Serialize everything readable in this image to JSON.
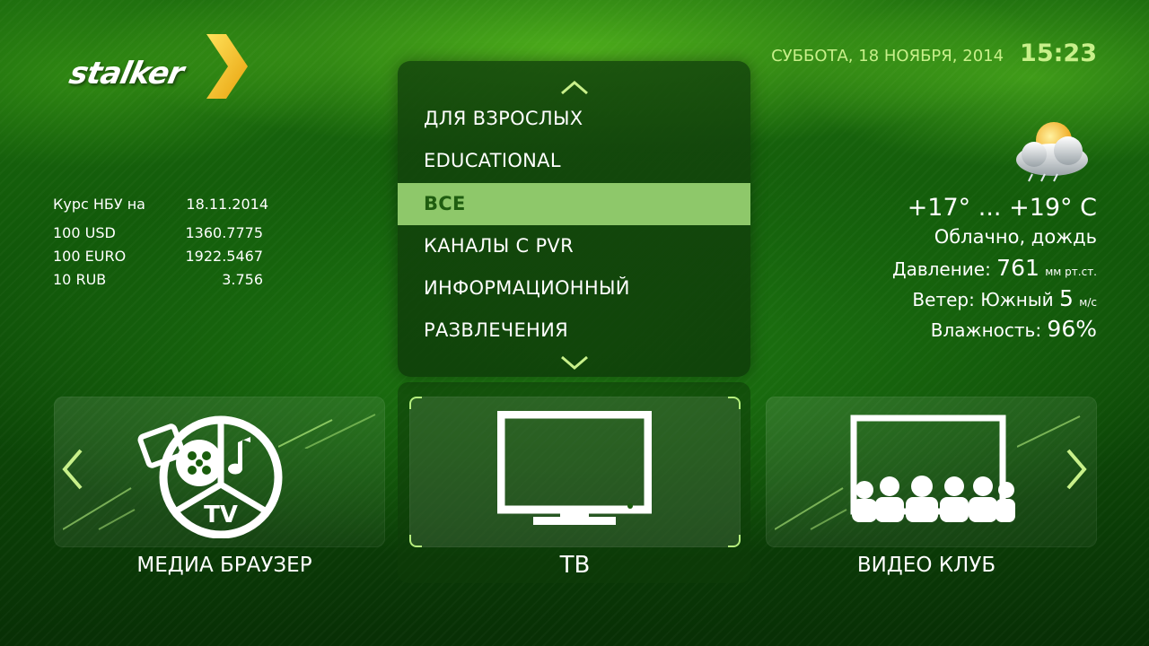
{
  "logo": {
    "text": "stalker"
  },
  "header": {
    "date": "СУББОТА, 18 НОЯБРЯ, 2014",
    "time": "15:23"
  },
  "currency": {
    "title": "Курс НБУ на",
    "date": "18.11.2014",
    "rows": [
      {
        "name": "100 USD",
        "value": "1360.7775"
      },
      {
        "name": "100 EURO",
        "value": "1922.5467"
      },
      {
        "name": "10 RUB",
        "value": "3.756"
      }
    ]
  },
  "weather": {
    "icon": "cloud-sun-rain-icon",
    "temperature": "+17° ... +19° C",
    "description": "Облачно, дождь",
    "pressure_label": "Давление:",
    "pressure_value": "761",
    "pressure_unit": "мм рт.ст.",
    "wind_label": "Ветер: Южный",
    "wind_value": "5",
    "wind_unit": "м/с",
    "humidity_label": "Влажность:",
    "humidity_value": "96%"
  },
  "menu": {
    "items": [
      {
        "label": "ДЛЯ ВЗРОСЛЫХ",
        "selected": false
      },
      {
        "label": "EDUCATIONAL",
        "selected": false
      },
      {
        "label": "ВСЕ",
        "selected": true
      },
      {
        "label": "КАНАЛЫ С PVR",
        "selected": false
      },
      {
        "label": "ИНФОРМАЦИОННЫЙ",
        "selected": false
      },
      {
        "label": "РАЗВЛЕЧЕНИЯ",
        "selected": false
      }
    ]
  },
  "tiles": {
    "media": {
      "label": "МЕДИА БРАУЗЕР",
      "icon_text": "TV"
    },
    "tv": {
      "label": "ТВ"
    },
    "video": {
      "label": "ВИДЕО КЛУБ"
    }
  },
  "colors": {
    "accent": "#c8f08a",
    "selection": "#8ec86a",
    "logo_chevron": "#f6c21c"
  }
}
